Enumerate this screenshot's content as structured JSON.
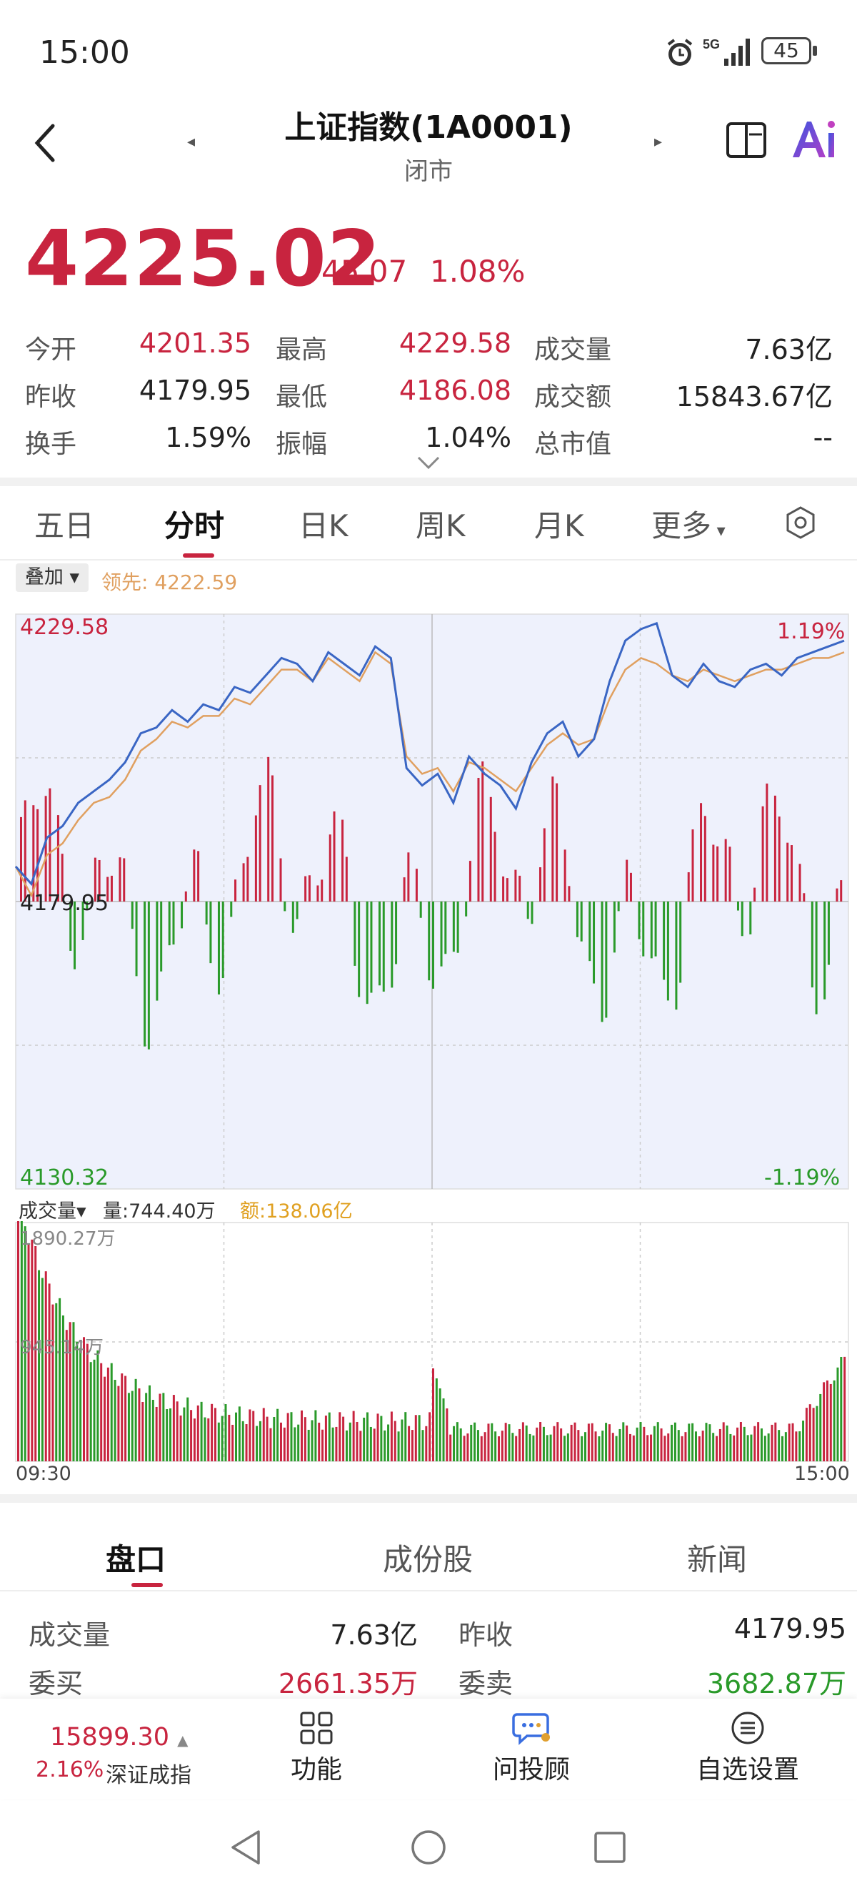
{
  "status": {
    "time": "15:00",
    "battery": "45"
  },
  "header": {
    "title": "上证指数(1A0001)",
    "subtitle": "闭市"
  },
  "quote": {
    "price": "4225.02",
    "change": "45.07",
    "change_pct": "1.08%"
  },
  "stats": [
    {
      "label": "今开",
      "value": "4201.35",
      "color": "red"
    },
    {
      "label": "最高",
      "value": "4229.58",
      "color": "red"
    },
    {
      "label": "成交量",
      "value": "7.63亿",
      "color": "black"
    },
    {
      "label": "昨收",
      "value": "4179.95",
      "color": "black"
    },
    {
      "label": "最低",
      "value": "4186.08",
      "color": "red"
    },
    {
      "label": "成交额",
      "value": "15843.67亿",
      "color": "black"
    },
    {
      "label": "换手",
      "value": "1.59%",
      "color": "black"
    },
    {
      "label": "振幅",
      "value": "1.04%",
      "color": "black"
    },
    {
      "label": "总市值",
      "value": "--",
      "color": "black"
    }
  ],
  "period_tabs": [
    "五日",
    "分时",
    "日K",
    "周K",
    "月K",
    "更多"
  ],
  "overlay": {
    "button": "叠加",
    "leader_label": "领先:",
    "leader_value": "4222.59"
  },
  "chart_labels": {
    "high": "4229.58",
    "high_pct": "1.19%",
    "mid": "4179.95",
    "low": "4130.32",
    "low_pct": "-1.19%",
    "vol_button": "成交量",
    "vol_qty": "量:744.40万",
    "vol_amt": "额:138.06亿",
    "vol_max": "1890.27万",
    "vol_mid": "945.14万",
    "time_start": "09:30",
    "time_end": "15:00"
  },
  "colors": {
    "up": "#c8243f",
    "down": "#2a9a2a",
    "index_line": "#3a66c4",
    "leader_line": "#e0a060",
    "fill": "#eef1fc"
  },
  "chart_data": {
    "type": "line",
    "title": "",
    "ylim": [
      4130.32,
      4229.58
    ],
    "x_range": [
      "09:30",
      "15:00"
    ],
    "series": [
      {
        "values": [
          4186,
          4183,
          4191,
          4193,
          4197,
          4199,
          4201,
          4204,
          4209,
          4210,
          4213,
          4211,
          4214,
          4213,
          4217,
          4216,
          4219,
          4222,
          4221,
          4218,
          4223,
          4221,
          4219,
          4224,
          4222,
          4203,
          4200,
          4202,
          4197,
          4205,
          4202,
          4200,
          4196,
          4204,
          4209,
          4211,
          4205,
          4208,
          4218,
          4225,
          4227,
          4228,
          4219,
          4217,
          4221,
          4218,
          4217,
          4220,
          4221,
          4219,
          4222,
          4223,
          4224,
          4225
        ]
      },
      {
        "values": [
          4186,
          4181,
          4188,
          4190,
          4194,
          4197,
          4198,
          4201,
          4206,
          4208,
          4211,
          4210,
          4212,
          4212,
          4215,
          4214,
          4217,
          4220,
          4220,
          4218,
          4222,
          4220,
          4218,
          4223,
          4221,
          4205,
          4202,
          4203,
          4199,
          4204,
          4203,
          4201,
          4199,
          4203,
          4207,
          4209,
          4207,
          4208,
          4215,
          4220,
          4222,
          4221,
          4219,
          4218,
          4220,
          4219,
          4218,
          4219,
          4220,
          4220,
          4221,
          4222,
          4222,
          4223
        ]
      }
    ]
  },
  "bottom_tabs": [
    "盘口",
    "成份股",
    "新闻"
  ],
  "orderbook": [
    {
      "label": "成交量",
      "value": "7.63亿",
      "color": "black"
    },
    {
      "label": "昨收",
      "value": "4179.95",
      "color": "black"
    },
    {
      "label": "委买",
      "value": "2661.35万",
      "color": "red"
    },
    {
      "label": "委卖",
      "value": "3682.87万",
      "color": "green"
    }
  ],
  "bottom_nav": {
    "index_value": "15899.30",
    "index_pct": "2.16%",
    "index_name": "深证成指",
    "items": [
      "功能",
      "问投顾",
      "自选设置"
    ]
  }
}
